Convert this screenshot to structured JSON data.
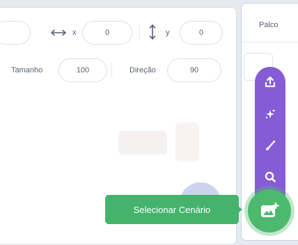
{
  "sprite_info": {
    "x_label": "x",
    "x_value": "0",
    "y_label": "y",
    "y_value": "0",
    "size_label": "Tamanho",
    "size_value": "100",
    "direction_label": "Direção",
    "direction_value": "90"
  },
  "stage": {
    "title": "Palco"
  },
  "backdrop_menu": {
    "tooltip": "Selecionar Cenário",
    "items": [
      {
        "icon": "upload-icon"
      },
      {
        "icon": "surprise-icon"
      },
      {
        "icon": "paint-icon"
      },
      {
        "icon": "search-icon"
      }
    ],
    "main_icon": "backdrop-add-icon"
  },
  "colors": {
    "menu_purple": "#855cd6",
    "button_green": "#4db96e",
    "panel_bg": "#e6ebf1"
  }
}
